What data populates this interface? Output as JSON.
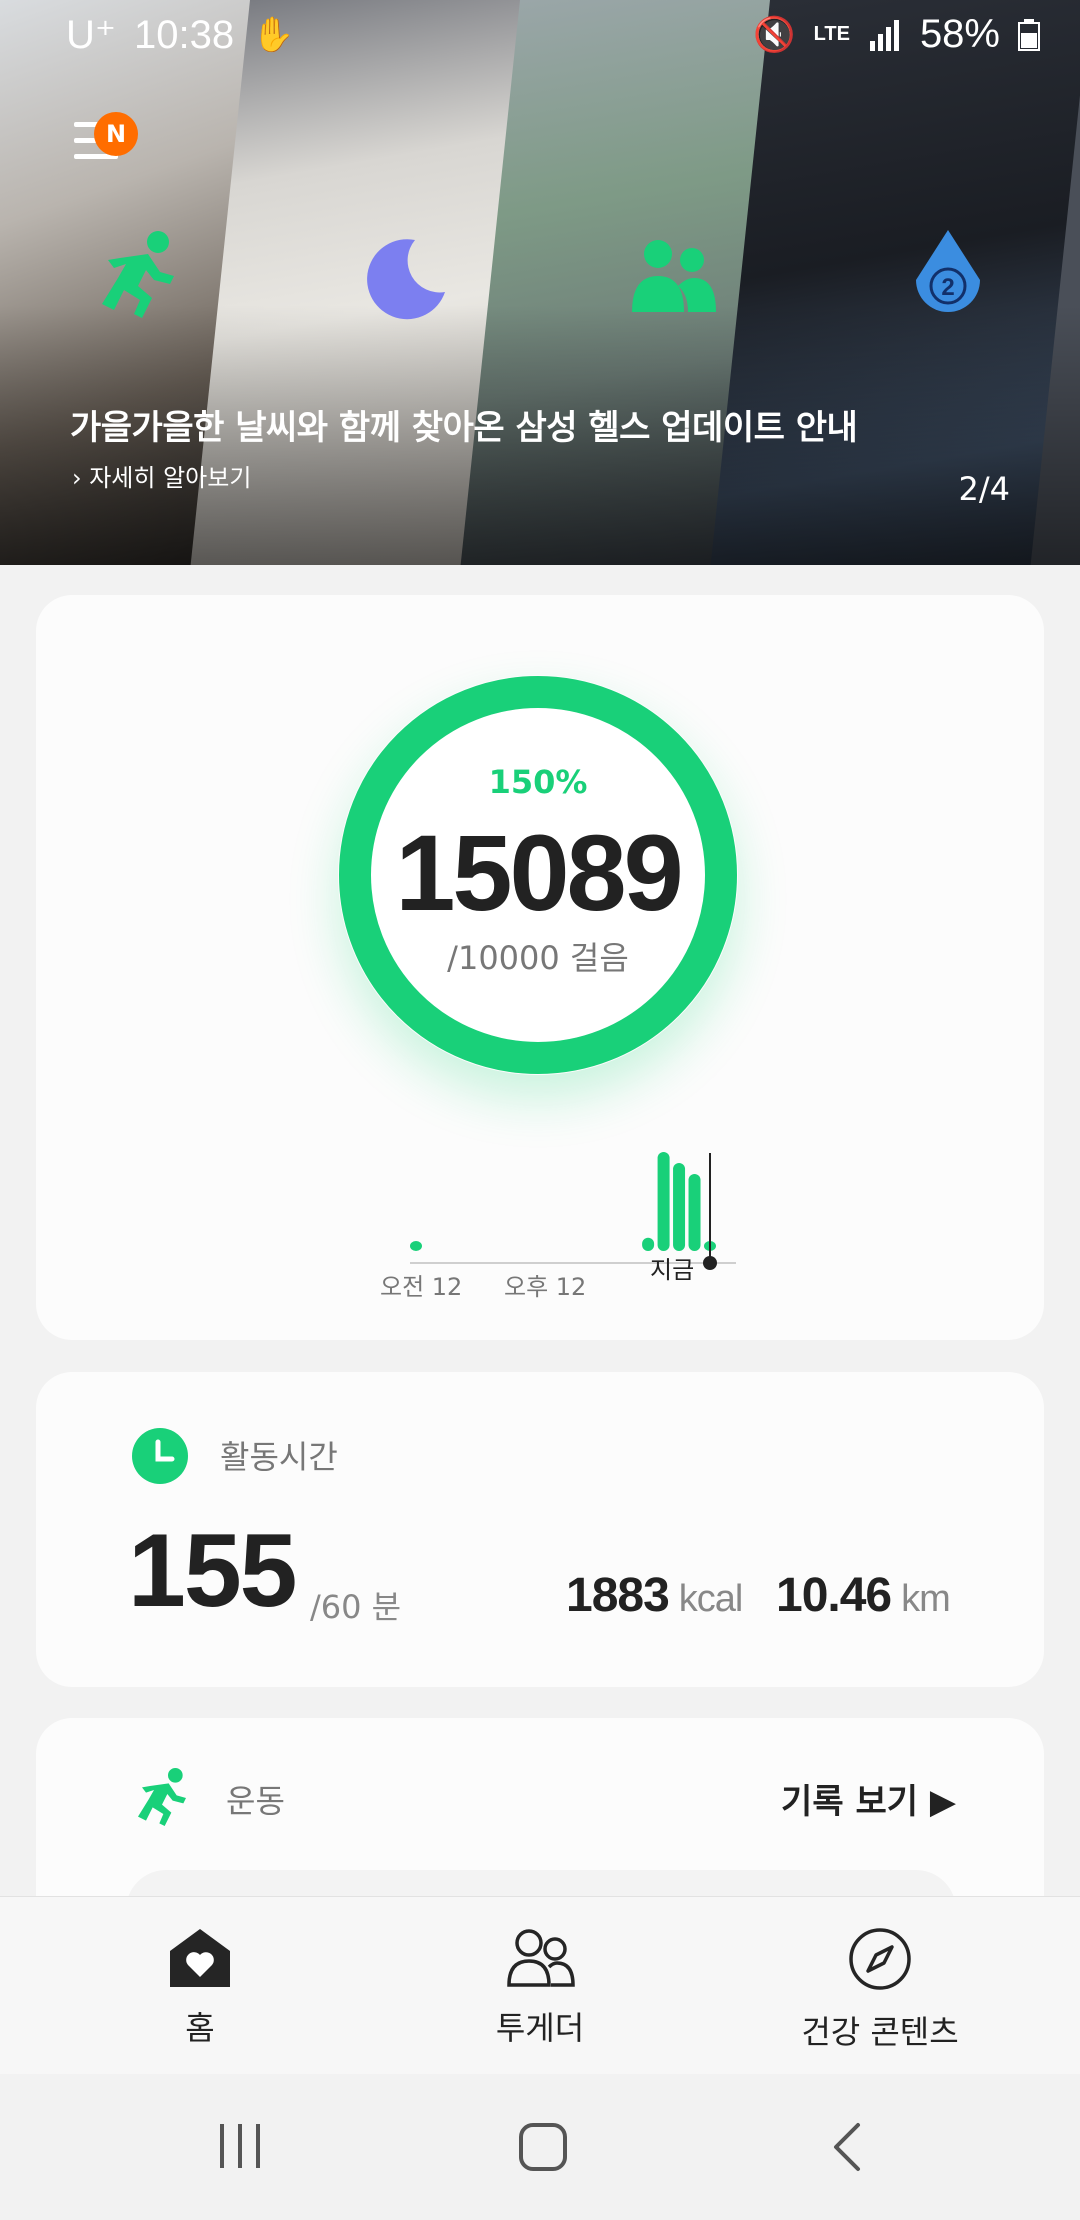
{
  "status_bar": {
    "carrier": "U⁺",
    "time": "10:38",
    "network": "LTE",
    "battery": "58%"
  },
  "hero": {
    "notification_badge": "N",
    "title": "가을가을한 날씨와 함께 찾아온 삼성 헬스 업데이트 안내",
    "link": "› 자세히 알아보기",
    "page_indicator": "2/4",
    "drop_badge": "2"
  },
  "steps": {
    "percent": "150%",
    "count": "15089",
    "goal": "/10000 걸음",
    "progress_fraction": 1.0,
    "ring_color": "#19d079",
    "hourly_bars": [
      {
        "hour": 0,
        "value": 0.08
      },
      {
        "hour": 15,
        "value": 0.12
      },
      {
        "hour": 16,
        "value": 0.9
      },
      {
        "hour": 17,
        "value": 0.8
      },
      {
        "hour": 18,
        "value": 0.7
      },
      {
        "hour": 19,
        "value": 0.08
      }
    ],
    "label_am": "오전 12",
    "label_pm": "오후 12",
    "label_now": "지금"
  },
  "active_time": {
    "title": "활동시간",
    "minutes": "155",
    "goal": "/60 분",
    "kcal_value": "1883",
    "kcal_unit": "kcal",
    "km_value": "10.46",
    "km_unit": "km"
  },
  "exercise": {
    "title": "운동",
    "view_records": "기록 보기 ▶"
  },
  "bottom_nav": {
    "home": "홈",
    "together": "투게더",
    "health_content": "건강 콘텐츠"
  },
  "colors": {
    "accent_green": "#19d079",
    "badge_orange": "#ff6d00",
    "moon_purple": "#7c7ff0",
    "drop_blue": "#3b8de0"
  }
}
